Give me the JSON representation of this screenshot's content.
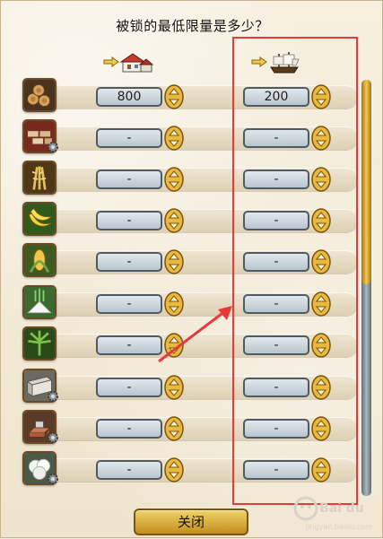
{
  "dialog": {
    "question": "被锁的最低限量是多少？",
    "close_label": "关闭"
  },
  "columns": [
    {
      "name": "warehouse",
      "icon": "house-icon"
    },
    {
      "name": "ship",
      "icon": "ship-icon"
    }
  ],
  "rows": [
    {
      "good": "timber",
      "icon": "wood-logs-icon",
      "has_gear": false,
      "warehouse_value": "800",
      "ship_value": "200"
    },
    {
      "good": "bricks",
      "icon": "bricks-icon",
      "has_gear": true,
      "warehouse_value": "-",
      "ship_value": "-"
    },
    {
      "good": "grain",
      "icon": "wheat-icon",
      "has_gear": false,
      "warehouse_value": "-",
      "ship_value": "-"
    },
    {
      "good": "fruit",
      "icon": "banana-icon",
      "has_gear": false,
      "warehouse_value": "-",
      "ship_value": "-"
    },
    {
      "good": "corn",
      "icon": "corn-icon",
      "has_gear": false,
      "warehouse_value": "-",
      "ship_value": "-"
    },
    {
      "good": "salt",
      "icon": "salt-icon",
      "has_gear": false,
      "warehouse_value": "-",
      "ship_value": "-"
    },
    {
      "good": "hemp",
      "icon": "hemp-leaf-icon",
      "has_gear": false,
      "warehouse_value": "-",
      "ship_value": "-"
    },
    {
      "good": "cloth",
      "icon": "cloth-icon",
      "has_gear": true,
      "warehouse_value": "-",
      "ship_value": "-"
    },
    {
      "good": "tools",
      "icon": "tools-icon",
      "has_gear": true,
      "warehouse_value": "-",
      "ship_value": "-"
    },
    {
      "good": "cotton",
      "icon": "cotton-icon",
      "has_gear": true,
      "warehouse_value": "-",
      "ship_value": "-"
    }
  ],
  "scrollbar": {
    "position_fraction": 0.0,
    "thumb_fraction": 0.49
  },
  "watermark": {
    "brand": "Bai du",
    "site": "jingyan.baidu.com"
  },
  "colors": {
    "highlight_box": "#e83a3a",
    "accent_gold": "#d9a536",
    "field_steel": "#b8c5cf"
  }
}
